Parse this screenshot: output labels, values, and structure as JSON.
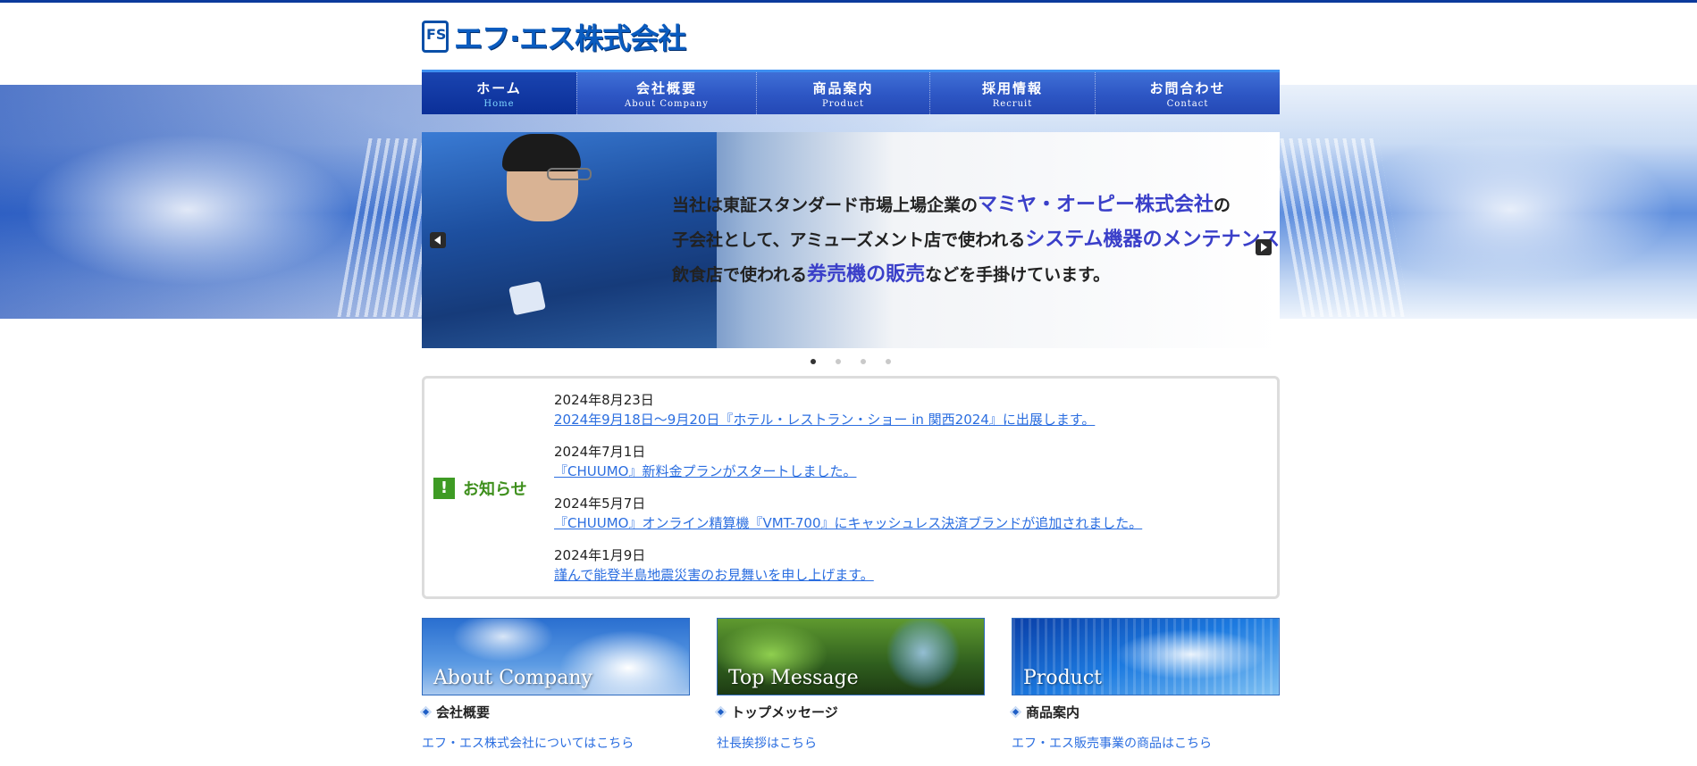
{
  "logo": {
    "text": "エフ·エス株式会社",
    "mark": "FS"
  },
  "nav": [
    {
      "jp": "ホーム",
      "en": "Home"
    },
    {
      "jp": "会社概要",
      "en": "About Company"
    },
    {
      "jp": "商品案内",
      "en": "Product"
    },
    {
      "jp": "採用情報",
      "en": "Recruit"
    },
    {
      "jp": "お問合わせ",
      "en": "Contact"
    }
  ],
  "slider": {
    "line1a": "当社は東証スタンダード市場上場企業の",
    "line1b": "マミヤ・オーピー株式会社",
    "line1c": "の",
    "line2a": "子会社として、アミューズメント店で使われる",
    "line2b": "システム機器のメンテナンス",
    "line2c": "、",
    "line3a": "飲食店で使われる",
    "line3b": "券売機の販売",
    "line3c": "などを手掛けています。",
    "active_slide": 1,
    "slide_count": 4
  },
  "news": {
    "icon": "!",
    "title": "お知らせ",
    "items": [
      {
        "date": "2024年8月23日",
        "text": "2024年9月18日〜9月20日『ホテル・レストラン・ショー in 関西2024』に出展します。"
      },
      {
        "date": "2024年7月1日",
        "text": "『CHUUMO』新料金プランがスタートしました。"
      },
      {
        "date": "2024年5月7日",
        "text": "『CHUUMO』オンライン精算機『VMT-700』にキャッシュレス決済ブランドが追加されました。"
      },
      {
        "date": "2024年1月9日",
        "text": "謹んで能登半島地震災害のお見舞いを申し上げます。"
      }
    ]
  },
  "cards": [
    {
      "caption": "About Company",
      "title": "会社概要",
      "link": "エフ・エス株式会社についてはこちら"
    },
    {
      "caption": "Top Message",
      "title": "トップメッセージ",
      "link": "社長挨拶はこちら"
    },
    {
      "caption": "Product",
      "title": "商品案内",
      "link": "エフ・エス販売事業の商品はこちら"
    }
  ],
  "colors": {
    "nav_blue": "#2d56c4",
    "news_green": "#3e8f1c",
    "link_blue": "#2b6ee0"
  }
}
